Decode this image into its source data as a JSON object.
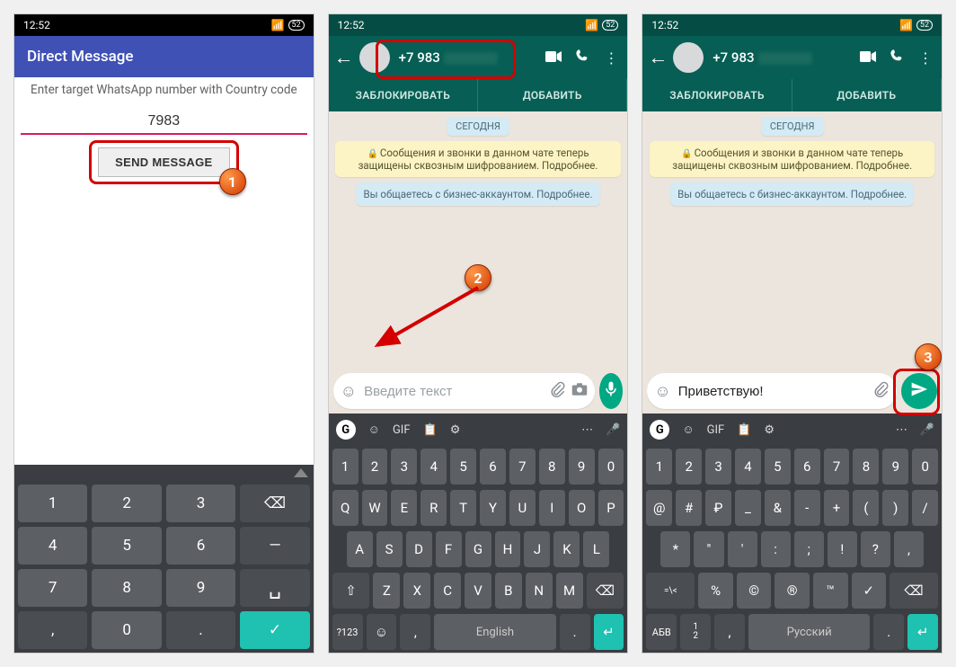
{
  "status": {
    "time": "12:52",
    "battery": "52"
  },
  "screen1": {
    "app_title": "Direct Message",
    "hint": "Enter target WhatsApp number with Country code",
    "phone_value": "7983",
    "send_label": "SEND MESSAGE",
    "callout": "1"
  },
  "numpad": {
    "keys": [
      [
        "1",
        "2",
        "3",
        "⌫"
      ],
      [
        "4",
        "5",
        "6",
        "—"
      ],
      [
        "7",
        "8",
        "9",
        ""
      ],
      [
        ",",
        "0",
        ".",
        "✓"
      ]
    ]
  },
  "whatsapp": {
    "contact_prefix": "+7 983",
    "tab_block": "ЗАБЛОКИРОВАТЬ",
    "tab_add": "ДОБАВИТЬ",
    "date_label": "СЕГОДНЯ",
    "encryption_text": "Сообщения и звонки в данном чате теперь защищены сквозным шифрованием. Подробнее.",
    "business_text": "Вы общаетесь с бизнес-аккаунтом. Подробнее.",
    "input_placeholder": "Введите текст",
    "input_value_s3": "Приветствую!",
    "callout2": "2",
    "callout3": "3"
  },
  "gboard": {
    "suggest": {
      "gif": "GIF"
    },
    "nums": [
      "1",
      "2",
      "3",
      "4",
      "5",
      "6",
      "7",
      "8",
      "9",
      "0"
    ],
    "row1_en": [
      "Q",
      "W",
      "E",
      "R",
      "T",
      "Y",
      "U",
      "I",
      "O",
      "P"
    ],
    "row2_en": [
      "A",
      "S",
      "D",
      "F",
      "G",
      "H",
      "J",
      "K",
      "L"
    ],
    "row3_en": [
      "Z",
      "X",
      "C",
      "V",
      "B",
      "N",
      "M"
    ],
    "space_en": "English",
    "sym_label": "?123",
    "row1_sym": [
      "@",
      "#",
      "₽",
      "_",
      "&",
      "-",
      "+",
      "(",
      ")",
      "/"
    ],
    "row2_sym": [
      "*",
      "\"",
      "'",
      ":",
      ";",
      "!",
      "?",
      ","
    ],
    "row3_sym_left": "=\\<",
    "row3_sym": [
      "%",
      "©",
      "®",
      "™",
      "✓"
    ],
    "space_ru": "Русский",
    "abv_label": "АБВ",
    "onetwo_label": "1\n2"
  }
}
